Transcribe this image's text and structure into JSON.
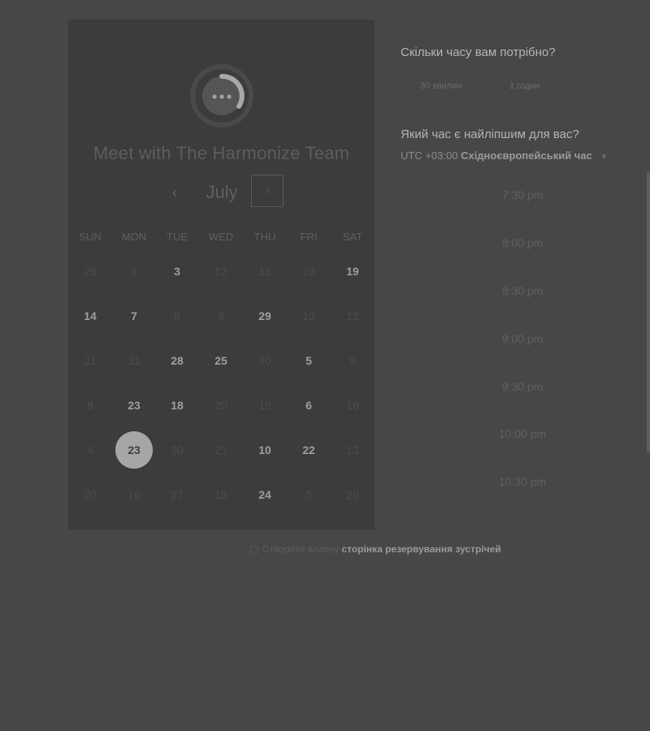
{
  "card": {
    "title": "Meet with The Harmonize Team",
    "logo_icon": "harmonize-logo-icon",
    "month": "July",
    "prev_icon": "chevron-left-icon",
    "next_icon": "chevron-right-icon",
    "weekdays": [
      "SUN",
      "MON",
      "TUE",
      "WED",
      "THU",
      "FRI",
      "SAT"
    ],
    "weeks": [
      [
        {
          "d": "26",
          "s": "muted"
        },
        {
          "d": "9",
          "s": "muted"
        },
        {
          "d": "3",
          "s": "avail"
        },
        {
          "d": "12",
          "s": "muted"
        },
        {
          "d": "13",
          "s": "muted"
        },
        {
          "d": "28",
          "s": "muted"
        },
        {
          "d": "19",
          "s": "avail"
        }
      ],
      [
        {
          "d": "14",
          "s": "avail"
        },
        {
          "d": "7",
          "s": "avail"
        },
        {
          "d": "8",
          "s": "muted"
        },
        {
          "d": "9",
          "s": "muted"
        },
        {
          "d": "29",
          "s": "avail"
        },
        {
          "d": "10",
          "s": "muted"
        },
        {
          "d": "12",
          "s": "muted"
        }
      ],
      [
        {
          "d": "21",
          "s": "muted"
        },
        {
          "d": "31",
          "s": "muted"
        },
        {
          "d": "28",
          "s": "avail"
        },
        {
          "d": "25",
          "s": "avail"
        },
        {
          "d": "30",
          "s": "muted"
        },
        {
          "d": "5",
          "s": "avail"
        },
        {
          "d": "9",
          "s": "muted"
        }
      ],
      [
        {
          "d": "8",
          "s": "muted"
        },
        {
          "d": "23",
          "s": "avail"
        },
        {
          "d": "18",
          "s": "avail"
        },
        {
          "d": "20",
          "s": "muted"
        },
        {
          "d": "15",
          "s": "muted"
        },
        {
          "d": "6",
          "s": "avail"
        },
        {
          "d": "16",
          "s": "muted"
        }
      ],
      [
        {
          "d": "4",
          "s": "muted"
        },
        {
          "d": "23",
          "s": "selected"
        },
        {
          "d": "30",
          "s": "muted"
        },
        {
          "d": "21",
          "s": "muted"
        },
        {
          "d": "10",
          "s": "avail"
        },
        {
          "d": "22",
          "s": "avail"
        },
        {
          "d": "13",
          "s": "muted"
        }
      ],
      [
        {
          "d": "20",
          "s": "muted"
        },
        {
          "d": "16",
          "s": "muted"
        },
        {
          "d": "27",
          "s": "muted"
        },
        {
          "d": "18",
          "s": "muted"
        },
        {
          "d": "24",
          "s": "avail"
        },
        {
          "d": "5",
          "s": "muted"
        },
        {
          "d": "29",
          "s": "muted"
        }
      ]
    ]
  },
  "duration": {
    "question": "Скільки часу вам потрібно?",
    "options": [
      "30 хвилин",
      "1 годин"
    ]
  },
  "time": {
    "question": "Який час є найліпшим для вас?",
    "tz_offset": "UTC +03:00",
    "tz_name": "Східноєвропейський час",
    "caret_icon": "caret-down-icon",
    "slots": [
      "7:30 pm",
      "8:00 pm",
      "8:30 pm",
      "9:00 pm",
      "9:30 pm",
      "10:00 pm",
      "10:30 pm"
    ]
  },
  "footer": {
    "icon": "calendar-icon",
    "text": "Створити власну",
    "link": "сторінка резервування зустрічей"
  },
  "colors": {
    "background": "#474747",
    "card": "#3c3c3c",
    "selected_day": "#a6a6a6"
  }
}
